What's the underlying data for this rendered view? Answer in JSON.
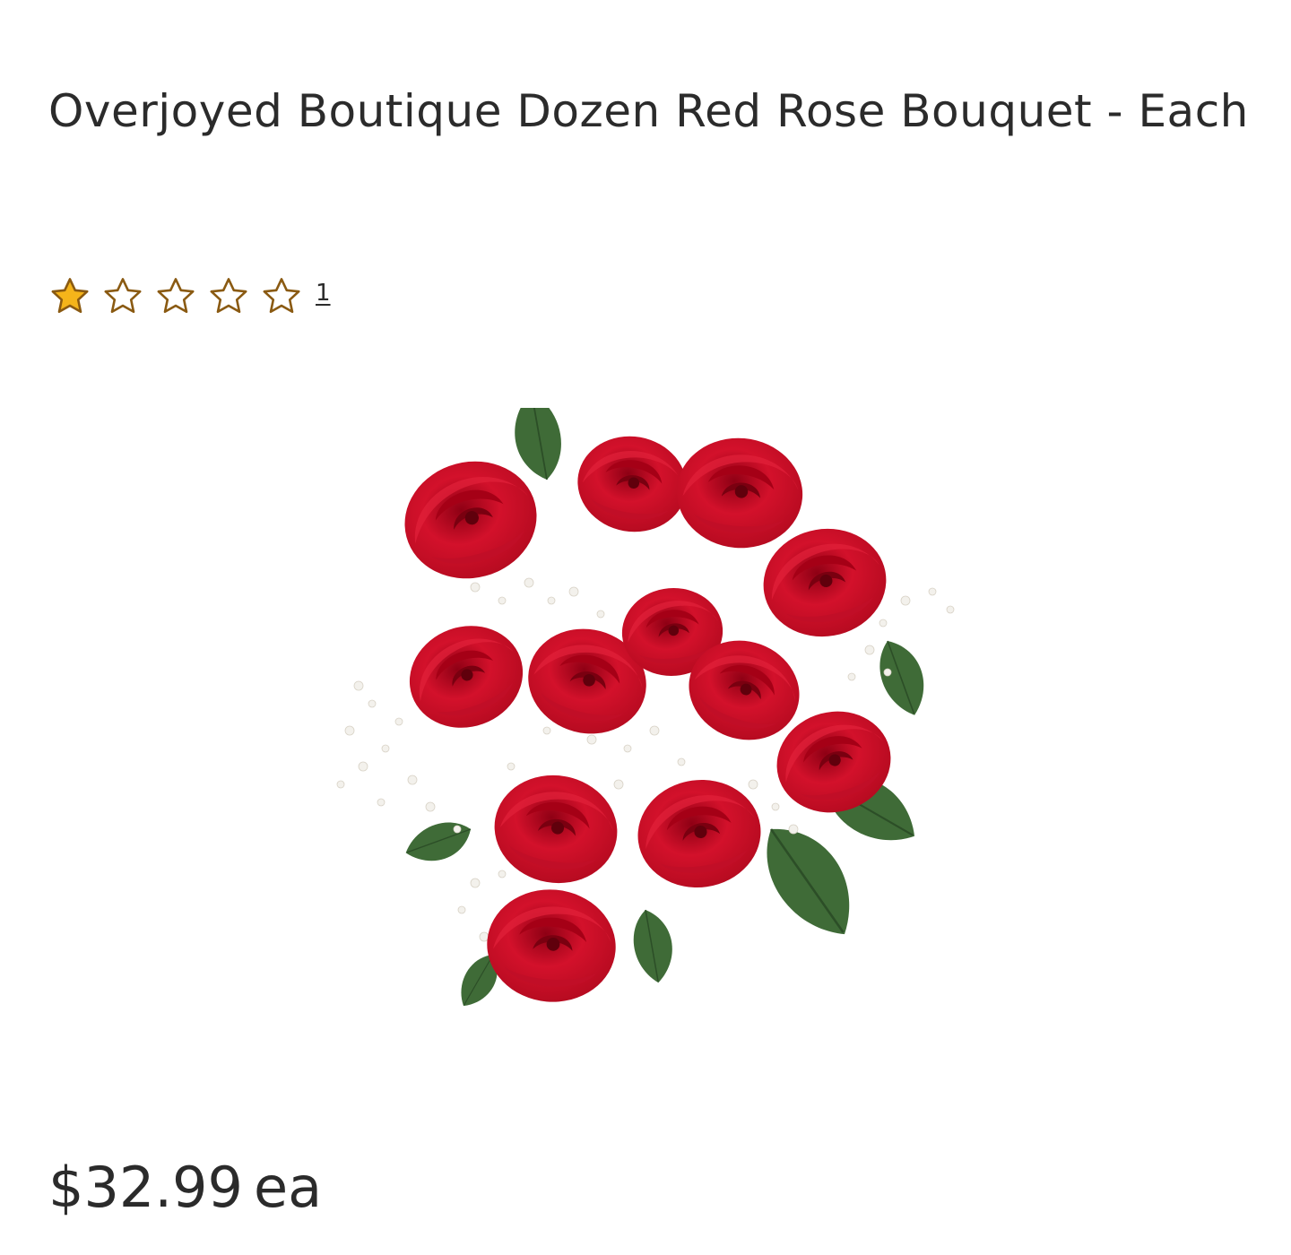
{
  "product": {
    "title": "Overjoyed Boutique Dozen Red Rose Bouquet - Each",
    "rating": {
      "value": 1,
      "max": 5,
      "review_count": "1",
      "filled_color": "#f5b41a",
      "outline_color": "#8a5a12"
    },
    "image_icon": "red-rose-bouquet-image",
    "price": {
      "amount": "$32.99",
      "unit": "ea"
    }
  }
}
